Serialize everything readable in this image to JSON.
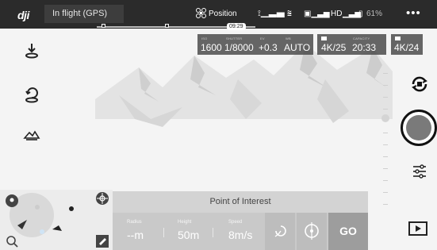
{
  "topbar": {
    "logo": "dji",
    "flight_status": "In flight (GPS)",
    "mode": "Position",
    "hd_label": "HD",
    "battery": "61%",
    "menu": "•••"
  },
  "timeline": {
    "time": "09:29"
  },
  "camera": {
    "iso_label": "ISO",
    "iso": "1600",
    "shutter_label": "SHUTTER",
    "shutter": "1/8000",
    "ev_label": "EV",
    "ev": "+0.3",
    "wb_label": "WB",
    "wb": "AUTO",
    "format": "4K/25",
    "capacity_label": "CAPACITY",
    "capacity": "20:33",
    "sd_format": "4K/24"
  },
  "poi": {
    "title": "Point of Interest",
    "radius_label": "Radius",
    "radius": "--m",
    "height_label": "Height",
    "height": "50m",
    "speed_label": "Speed",
    "speed": "8m/s",
    "go": "GO"
  },
  "icons": {
    "logo": "dji-logo",
    "mode": "drone-icon",
    "left_1": "takeoff-icon",
    "left_2": "return-home-icon",
    "left_3": "intelligent-flight-icon",
    "cam_switch": "camera-switch-icon",
    "settings": "sliders-icon",
    "playback": "play-icon"
  },
  "colors": {
    "topbar": "#2b2b2b",
    "panel": "#c9c9c9",
    "go_button": "#9d9d9d"
  }
}
